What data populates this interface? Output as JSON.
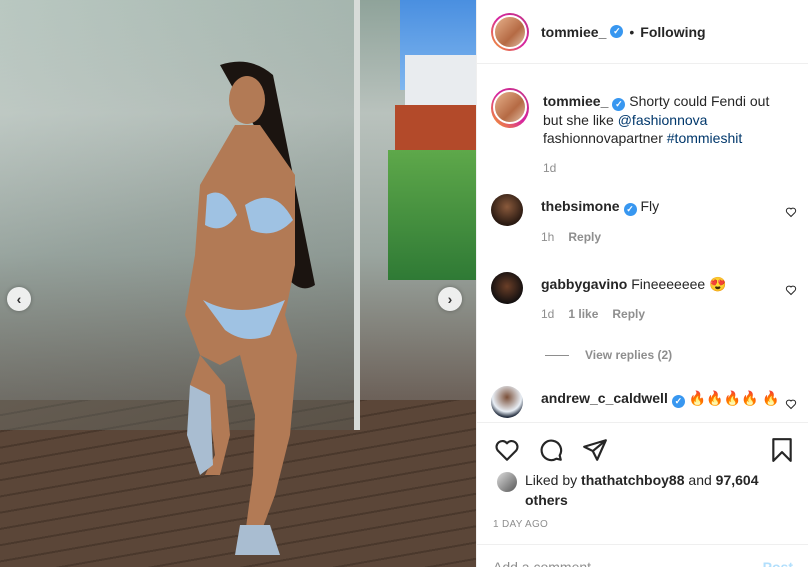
{
  "photo": {
    "alt_label": "",
    "prev_icon": "chevron-left-icon",
    "next_icon": "chevron-right-icon"
  },
  "header": {
    "username": "tommiee_",
    "separator": "•",
    "follow_state": "Following"
  },
  "caption": {
    "username": "tommiee_",
    "text_before": "Shorty could Fendi out but she like ",
    "mention": "@fashionnova",
    "text_mid": " fashionnovapartner ",
    "hashtag": "#tommieshit",
    "time": "1d"
  },
  "comments": [
    {
      "username": "thebsimone",
      "verified": true,
      "text": "Fly",
      "time": "1h",
      "likes": "",
      "reply": "Reply"
    },
    {
      "username": "gabbygavino",
      "verified": false,
      "text": "Fineeeeeee 😍",
      "time": "1d",
      "likes": "1 like",
      "reply": "Reply"
    },
    {
      "username": "andrew_c_caldwell",
      "verified": true,
      "text": "🔥🔥🔥🔥 🔥"
    }
  ],
  "view_replies": "View replies (2)",
  "likes": {
    "prefix": "Liked by ",
    "liker": "thathatchboy88",
    "mid": " and",
    "count": "97,604 others"
  },
  "date": "1 DAY AGO",
  "add_comment": {
    "placeholder": "Add a comment…",
    "post": "Post"
  },
  "colors": {
    "link": "#00376b",
    "verified": "#3897f0",
    "muted": "#8e8e8e"
  }
}
